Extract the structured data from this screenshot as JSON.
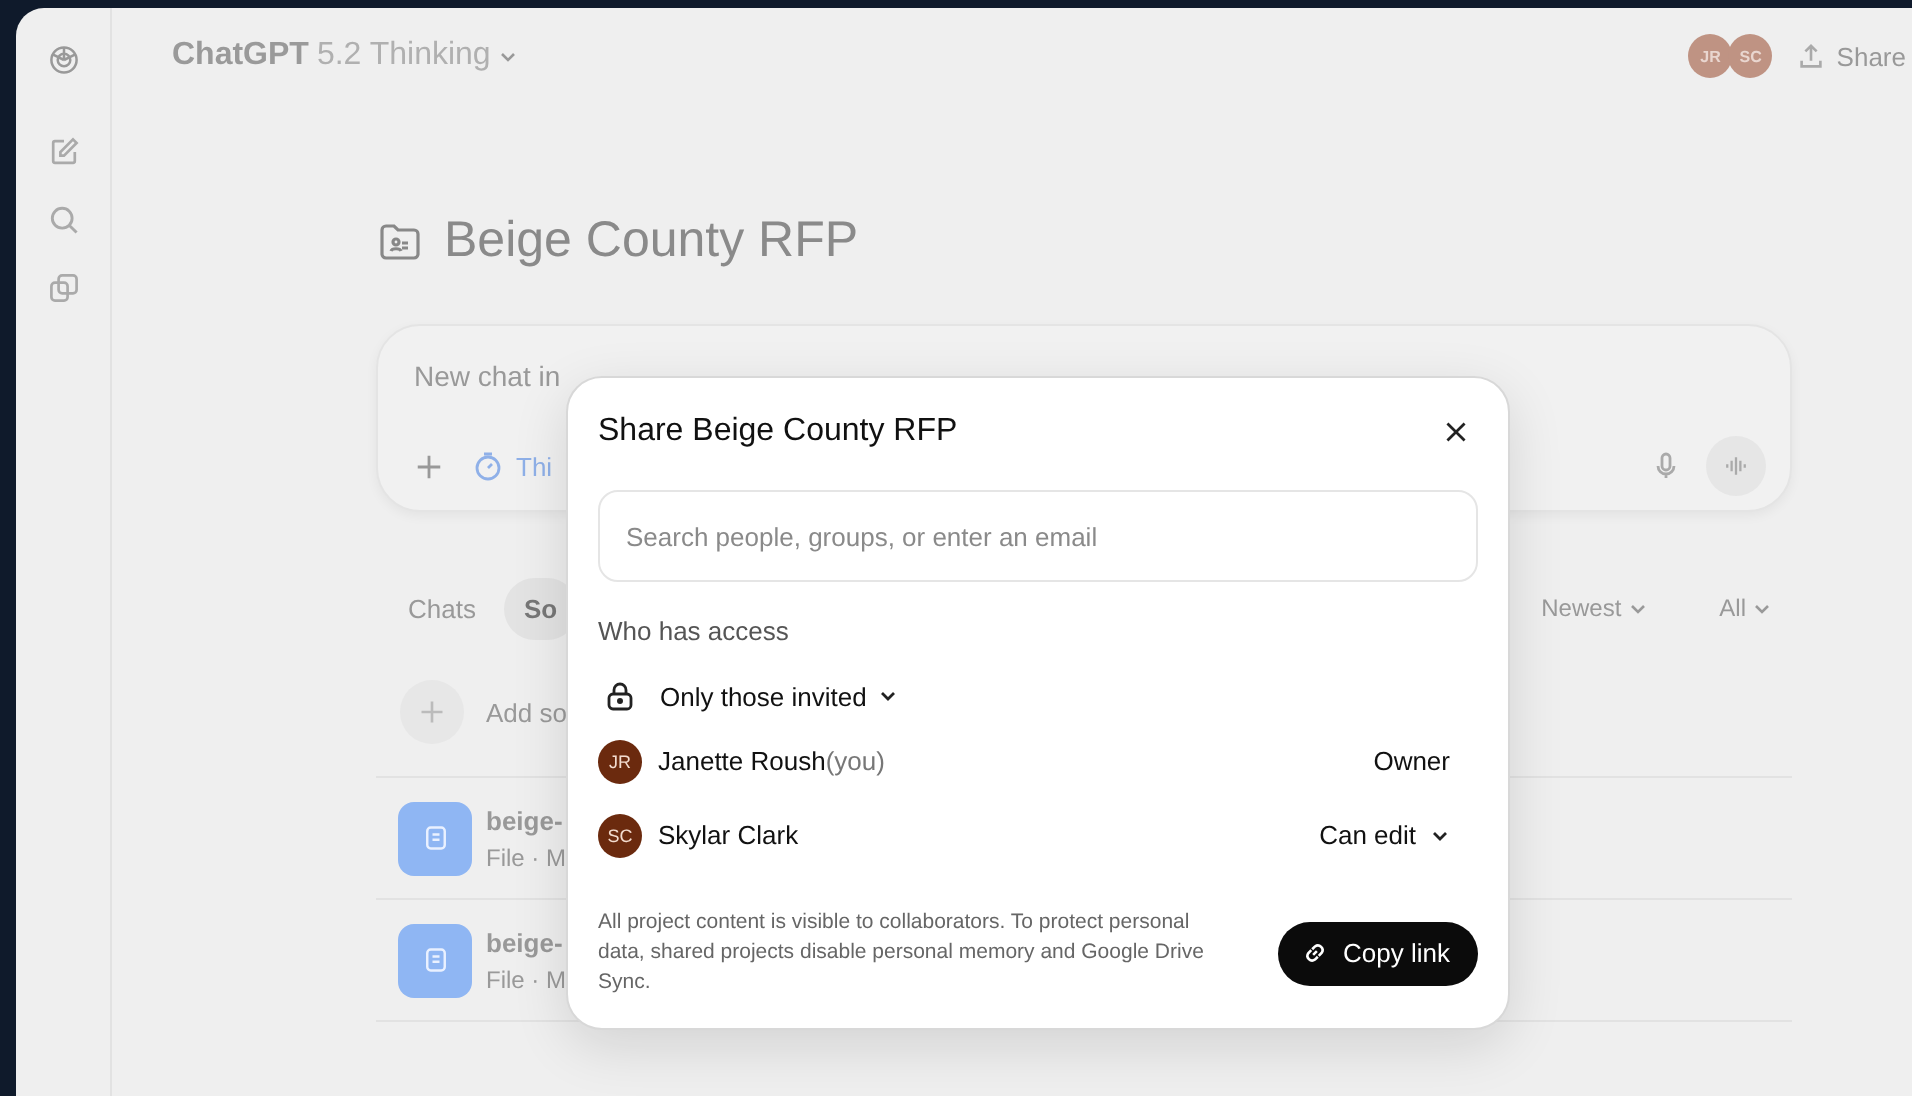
{
  "header": {
    "product": "ChatGPT",
    "model": "5.2 Thinking",
    "avatars": [
      {
        "initials": "JR"
      },
      {
        "initials": "SC"
      }
    ],
    "share": "Share"
  },
  "project": {
    "title": "Beige County RFP"
  },
  "composer": {
    "placeholder": "New chat in",
    "mode": "Thi"
  },
  "tabs": [
    {
      "label": "Chats",
      "selected": false
    },
    {
      "label": "So",
      "selected": true
    }
  ],
  "filters": [
    "Newest",
    "All"
  ],
  "add_label": "Add so",
  "files": [
    {
      "name": "beige-",
      "meta": "File · M"
    },
    {
      "name": "beige-",
      "meta": "File · M"
    }
  ],
  "dialog": {
    "title": "Share Beige County RFP",
    "search_placeholder": "Search people, groups, or enter an email",
    "section": "Who has access",
    "access": "Only those invited",
    "members": [
      {
        "initials": "JR",
        "name": "Janette Roush",
        "note": "(you)",
        "role": "Owner",
        "role_menu": false
      },
      {
        "initials": "SC",
        "name": "Skylar Clark",
        "role": "Can edit",
        "role_menu": true
      }
    ],
    "note": "All project content is visible to collaborators. To protect personal data, shared projects disable personal memory and Google Drive Sync.",
    "copy": "Copy link"
  }
}
